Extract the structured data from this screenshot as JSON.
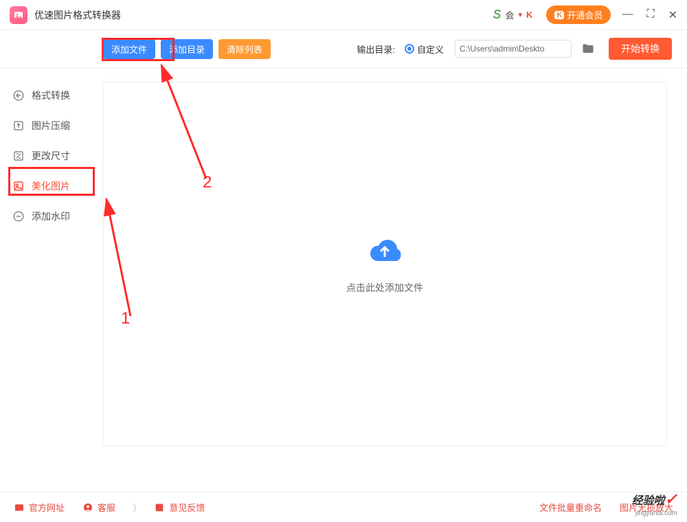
{
  "app": {
    "title": "优速图片格式转换器"
  },
  "titlebar": {
    "user_name": "会",
    "vip_label": "开通会员"
  },
  "toolbar": {
    "add_file": "添加文件",
    "add_folder": "添加目录",
    "clear_list": "清除列表",
    "output_label": "输出目录:",
    "custom_label": "自定义",
    "output_path": "C:\\Users\\admin\\Deskto",
    "start_label": "开始转换"
  },
  "sidebar": {
    "items": [
      {
        "label": "格式转换",
        "icon": "convert-icon"
      },
      {
        "label": "图片压缩",
        "icon": "compress-icon"
      },
      {
        "label": "更改尺寸",
        "icon": "resize-icon"
      },
      {
        "label": "美化图片",
        "icon": "beautify-icon"
      },
      {
        "label": "添加水印",
        "icon": "watermark-icon"
      }
    ],
    "active_index": 3
  },
  "dropzone": {
    "hint": "点击此处添加文件"
  },
  "footer": {
    "official_site": "官方网址",
    "support": "客服",
    "feedback": "意见反馈",
    "batch_rename": "文件批量重命名",
    "lossless_zoom": "图片无损放大"
  },
  "annotations": {
    "step1": "1",
    "step2": "2"
  },
  "watermark": {
    "main": "经验啦",
    "sub": "jingyanla.com"
  }
}
